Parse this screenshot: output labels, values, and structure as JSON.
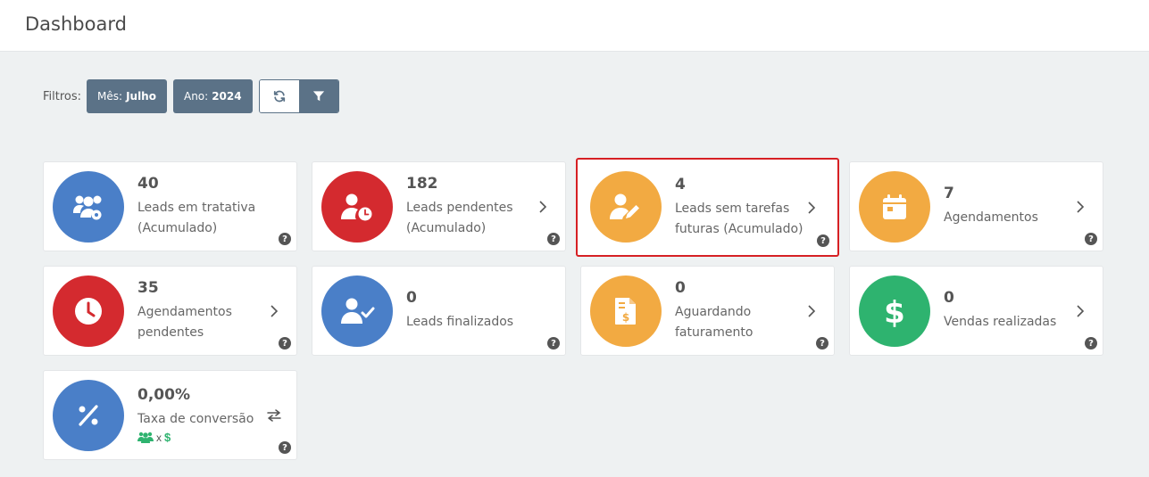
{
  "header": {
    "title": "Dashboard"
  },
  "filters": {
    "label": "Filtros:",
    "month_key": "Mês:",
    "month_value": "Julho",
    "year_key": "Ano:",
    "year_value": "2024"
  },
  "cards": [
    {
      "value": "40",
      "label": "Leads em tratativa (Acumulado)",
      "icon": "users-gear-icon",
      "color": "#4a7fc8",
      "has_chevron": false,
      "help": "?"
    },
    {
      "value": "182",
      "label": "Leads pendentes (Acumulado)",
      "icon": "user-clock-icon",
      "color": "#d42a2f",
      "has_chevron": true,
      "help": "?"
    },
    {
      "value": "4",
      "label": "Leads sem tarefas futuras (Acumulado)",
      "icon": "user-pen-icon",
      "color": "#f2aa42",
      "has_chevron": true,
      "help": "?"
    },
    {
      "value": "7",
      "label": "Agendamentos",
      "icon": "calendar-icon",
      "color": "#f2aa42",
      "has_chevron": true,
      "help": "?"
    },
    {
      "value": "35",
      "label": "Agendamentos pendentes",
      "icon": "clock-icon",
      "color": "#d42a2f",
      "has_chevron": true,
      "help": "?"
    },
    {
      "value": "0",
      "label": "Leads finalizados",
      "icon": "user-check-icon",
      "color": "#4a7fc8",
      "has_chevron": false,
      "help": "?"
    },
    {
      "value": "0",
      "label": "Aguardando faturamento",
      "icon": "invoice-dollar-icon",
      "color": "#f2aa42",
      "has_chevron": true,
      "help": "?"
    },
    {
      "value": "0",
      "label": "Vendas realizadas",
      "icon": "dollar-icon",
      "color": "#2eb36f",
      "has_chevron": true,
      "help": "?"
    },
    {
      "value": "0,00%",
      "label": "Taxa de conversão",
      "icon": "percent-icon",
      "color": "#4a7fc8",
      "has_chevron": false,
      "help": "?",
      "sub_x": "x",
      "sub_dollar": "$"
    }
  ]
}
